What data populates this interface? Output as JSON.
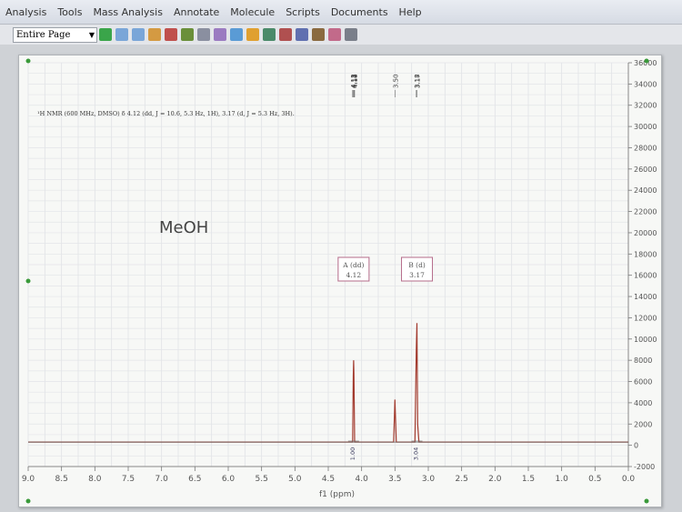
{
  "menu": [
    "Analysis",
    "Tools",
    "Mass Analysis",
    "Annotate",
    "Molecule",
    "Scripts",
    "Documents",
    "Help"
  ],
  "toolbar": {
    "page_mode": "Entire Page"
  },
  "spectrum": {
    "description": "¹H NMR (600 MHz, DMSO) δ 4.12 (dd, J = 10.6, 5.3 Hz, 1H), 3.17 (d, J = 5.3 Hz, 3H).",
    "solvent_label": "MeOH",
    "x_axis_label": "f1 (ppm)",
    "x_ticks": [
      "9.0",
      "8.5",
      "8.0",
      "7.5",
      "7.0",
      "6.5",
      "6.0",
      "5.5",
      "5.0",
      "4.5",
      "4.0",
      "3.5",
      "3.0",
      "2.5",
      "2.0",
      "1.5",
      "1.0",
      "0.5",
      "0.0"
    ],
    "y_ticks": [
      "36000",
      "34000",
      "32000",
      "30000",
      "28000",
      "26000",
      "24000",
      "22000",
      "20000",
      "18000",
      "16000",
      "14000",
      "12000",
      "10000",
      "8000",
      "6000",
      "4000",
      "2000",
      "0",
      "-2000"
    ],
    "peak_labels": [
      "4.13",
      "4.12",
      "4.11",
      "4.10",
      "3.50",
      "3.18",
      "3.17"
    ],
    "multiplets": [
      {
        "id": "A",
        "type": "dd",
        "shift": "4.12",
        "integral": "1.00"
      },
      {
        "id": "B",
        "type": "d",
        "shift": "3.17",
        "integral": "3.04"
      }
    ]
  },
  "chart_data": {
    "type": "line",
    "title": "",
    "xlabel": "f1 (ppm)",
    "ylabel": "",
    "xlim": [
      9.0,
      0.0
    ],
    "ylim": [
      -2000,
      36000
    ],
    "x_reversed": true,
    "grid": true,
    "series": [
      {
        "x": [
          9.0,
          4.135,
          4.125,
          4.12,
          4.115,
          4.105,
          3.52,
          3.5,
          3.48,
          3.2,
          3.18,
          3.17,
          3.16,
          3.14,
          2.6,
          0.0
        ],
        "values": [
          300,
          300,
          6500,
          8000,
          6800,
          300,
          300,
          4300,
          300,
          300,
          9000,
          11500,
          2000,
          300,
          300,
          300
        ]
      }
    ]
  }
}
